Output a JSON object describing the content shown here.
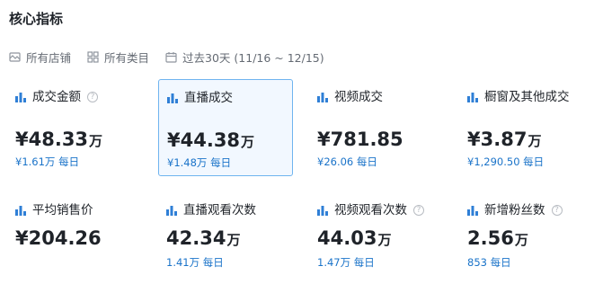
{
  "section_title": "核心指标",
  "filters": {
    "shop": "所有店铺",
    "category": "所有类目",
    "date_range": "过去30天 (11/16 ~ 12/15)"
  },
  "cards": [
    {
      "label": "成交金额",
      "value": "¥48.33",
      "unit": "万",
      "sub": "¥1.61万 每日",
      "help": true,
      "selected": false
    },
    {
      "label": "直播成交",
      "value": "¥44.38",
      "unit": "万",
      "sub": "¥1.48万 每日",
      "help": false,
      "selected": true
    },
    {
      "label": "视频成交",
      "value": "¥781.85",
      "unit": "",
      "sub": "¥26.06 每日",
      "help": false,
      "selected": false
    },
    {
      "label": "橱窗及其他成交",
      "value": "¥3.87",
      "unit": "万",
      "sub": "¥1,290.50 每日",
      "help": false,
      "selected": false
    },
    {
      "label": "平均销售价",
      "value": "¥204.26",
      "unit": "",
      "sub": "",
      "help": false,
      "selected": false
    },
    {
      "label": "直播观看次数",
      "value": "42.34",
      "unit": "万",
      "sub": "1.41万 每日",
      "help": false,
      "selected": false
    },
    {
      "label": "视频观看次数",
      "value": "44.03",
      "unit": "万",
      "sub": "1.47万 每日",
      "help": true,
      "selected": false
    },
    {
      "label": "新增粉丝数",
      "value": "2.56",
      "unit": "万",
      "sub": "853 每日",
      "help": true,
      "selected": false
    }
  ],
  "colors": {
    "accent": "#1a73c9",
    "selected_bg": "#f2f8ff",
    "selected_border": "#6fb4ef",
    "icon_blue": "#2f7fd6"
  },
  "icons": {
    "card": "bar-chart-icon",
    "help": "question-circle-icon",
    "shop": "shop-icon",
    "category": "grid-icon",
    "date": "calendar-icon"
  }
}
